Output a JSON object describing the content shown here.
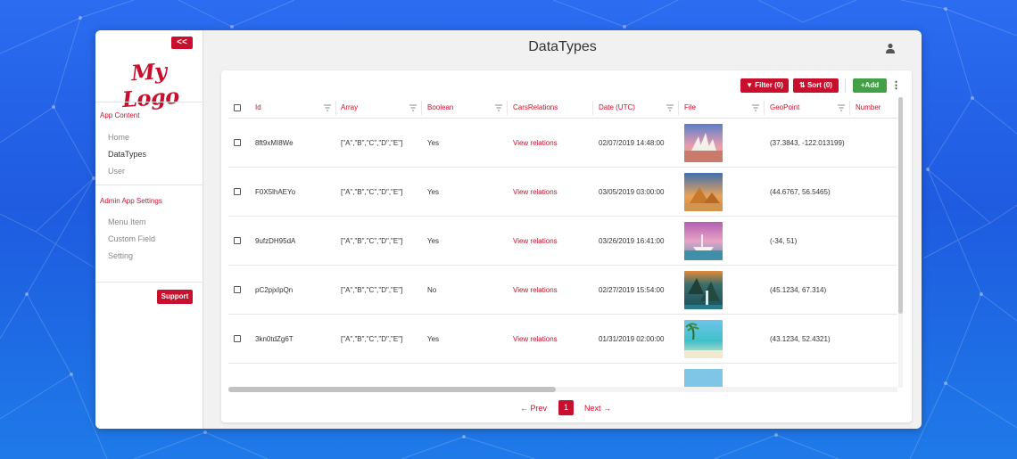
{
  "sidebar": {
    "collapse_label": "<<",
    "logo_text": "My Logo",
    "sections": [
      {
        "title": "App Content",
        "items": [
          "Home",
          "DataTypes",
          "User"
        ]
      },
      {
        "title": "Admin App Settings",
        "items": [
          "Menu Item",
          "Custom Field",
          "Setting"
        ]
      }
    ],
    "active_item": "DataTypes",
    "support_label": "Support"
  },
  "header": {
    "title": "DataTypes"
  },
  "toolbar": {
    "filter_label": "Filter (0)",
    "sort_label": "Sort (0)",
    "add_label": "Add"
  },
  "table": {
    "columns": [
      "Id",
      "Array",
      "Boolean",
      "CarsRelations",
      "Date (UTC)",
      "File",
      "GeoPoint",
      "Number"
    ],
    "rows": [
      {
        "id": "8ft9xMI8We",
        "array": "[\"A\",\"B\",\"C\",\"D\",\"E\"]",
        "boolean": "Yes",
        "relation": "View relations",
        "date": "02/07/2019 14:48:00",
        "file": "opera-house-sunset",
        "geopoint": "(37.3843, -122.013199)"
      },
      {
        "id": "F0X5lhAEYo",
        "array": "[\"A\",\"B\",\"C\",\"D\",\"E\"]",
        "boolean": "Yes",
        "relation": "View relations",
        "date": "03/05/2019 03:00:00",
        "file": "pyramids",
        "geopoint": "(44.6767, 56.5465)"
      },
      {
        "id": "9ufzDH95dA",
        "array": "[\"A\",\"B\",\"C\",\"D\",\"E\"]",
        "boolean": "Yes",
        "relation": "View relations",
        "date": "03/26/2019 16:41:00",
        "file": "harbor-sunset",
        "geopoint": "(-34, 51)"
      },
      {
        "id": "pC2pjxIpQn",
        "array": "[\"A\",\"B\",\"C\",\"D\",\"E\"]",
        "boolean": "No",
        "relation": "View relations",
        "date": "02/27/2019 15:54:00",
        "file": "waterfall",
        "geopoint": "(45.1234, 67.314)"
      },
      {
        "id": "3kn0tdZg6T",
        "array": "[\"A\",\"B\",\"C\",\"D\",\"E\"]",
        "boolean": "Yes",
        "relation": "View relations",
        "date": "01/31/2019 02:00:00",
        "file": "tropical-beach",
        "geopoint": "(43.1234, 52.4321)"
      }
    ]
  },
  "pagination": {
    "prev_label": "Prev",
    "current_page": "1",
    "next_label": "Next"
  },
  "colors": {
    "accent": "#c8102e",
    "add": "#43a047",
    "background": "#2b6cf0"
  }
}
